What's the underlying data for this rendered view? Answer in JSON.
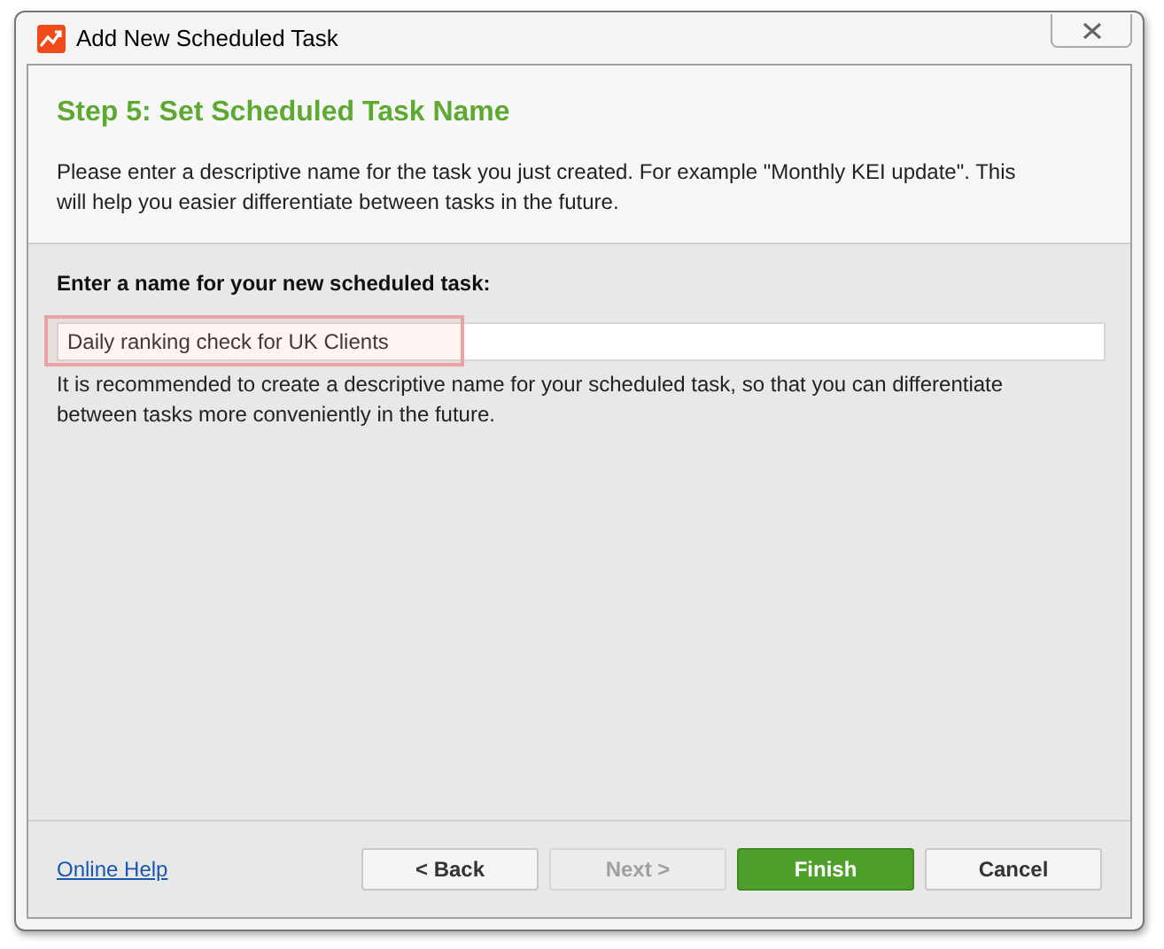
{
  "window": {
    "title": "Add New Scheduled Task"
  },
  "header": {
    "title": "Step 5: Set Scheduled Task Name",
    "description": "Please enter a descriptive name for the task you just created. For example \"Monthly KEI update\". This will help you easier differentiate between tasks in the future."
  },
  "field": {
    "label": "Enter a name for your new scheduled task:",
    "value": "Daily ranking check for UK Clients",
    "highlighted": true,
    "hint": "It is recommended to create a descriptive name for your scheduled task, so that you can differentiate between tasks more conveniently in the future."
  },
  "footer": {
    "help_link": "Online Help",
    "buttons": [
      {
        "label": "< Back",
        "kind": "default",
        "disabled": false
      },
      {
        "label": "Next >",
        "kind": "default",
        "disabled": true
      },
      {
        "label": "Finish",
        "kind": "primary",
        "disabled": false
      },
      {
        "label": "Cancel",
        "kind": "default",
        "disabled": false
      }
    ]
  }
}
